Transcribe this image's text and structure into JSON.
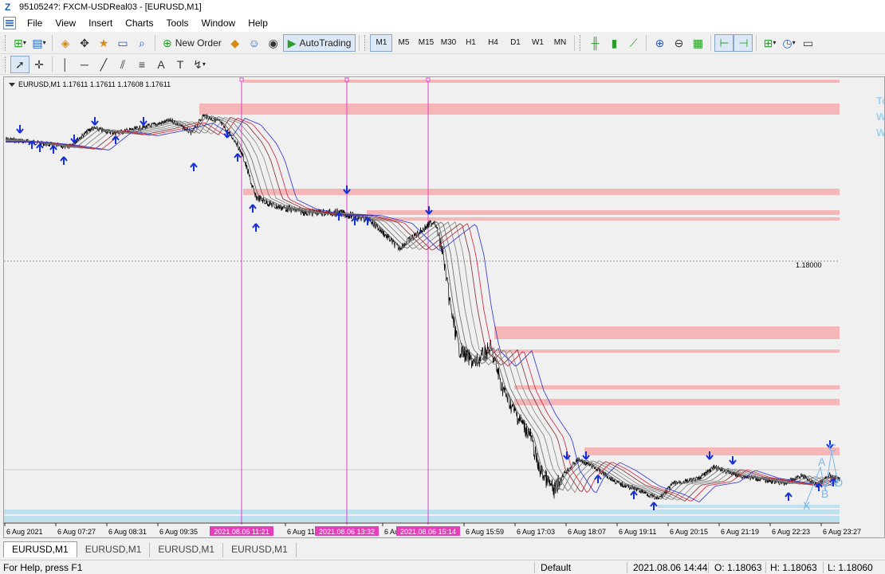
{
  "window": {
    "title": "9510524?: FXCM-USDReal03 - [EURUSD,M1]"
  },
  "menu": {
    "items": [
      "File",
      "View",
      "Insert",
      "Charts",
      "Tools",
      "Window",
      "Help"
    ]
  },
  "toolbar": {
    "new_order": "New Order",
    "autotrading": "AutoTrading",
    "timeframes": [
      "M1",
      "M5",
      "M15",
      "M30",
      "H1",
      "H4",
      "D1",
      "W1",
      "MN"
    ],
    "active_timeframe": "M1"
  },
  "chart": {
    "header": "EURUSD,M1  1.17611 1.17611 1.17608 1.17611",
    "price_label": "1.18000",
    "right_text": [
      "To",
      "W",
      "W"
    ],
    "time_labels": [
      "6 Aug 2021",
      "6 Aug 07:27",
      "6 Aug 08:31",
      "6 Aug 09:35",
      "6 Aug 11:43",
      "6 Aug 13:5",
      "6 Aug 15:59",
      "6 Aug 17:03",
      "6 Aug 18:07",
      "6 Aug 19:11",
      "6 Aug 20:15",
      "6 Aug 21:19",
      "6 Aug 22:23",
      "6 Aug 23:27"
    ],
    "vline_labels": [
      "2021.08.06 11:21",
      "2021.08.06 13:32",
      "2021.08.06 15:14"
    ],
    "pattern_labels": [
      "C",
      "A",
      "B",
      "D",
      "X"
    ],
    "colors": {
      "zone": "#f4b6b6",
      "zone_blue": "#bfe0ee",
      "vline": "#e040c8",
      "vlabel_bg": "#e23fb8",
      "arrow": "#1530d8",
      "ema_red": "#d0203a",
      "ema_blue": "#2a30c8",
      "pattern": "#7ab8e8"
    }
  },
  "tabs": [
    "EURUSD,M1",
    "EURUSD,M1",
    "EURUSD,M1",
    "EURUSD,M1"
  ],
  "status": {
    "help": "For Help, press F1",
    "profile": "Default",
    "datetime": "2021.08.06 14:44",
    "open": "O: 1.18063",
    "high": "H: 1.18063",
    "low": "L: 1.18060"
  }
}
